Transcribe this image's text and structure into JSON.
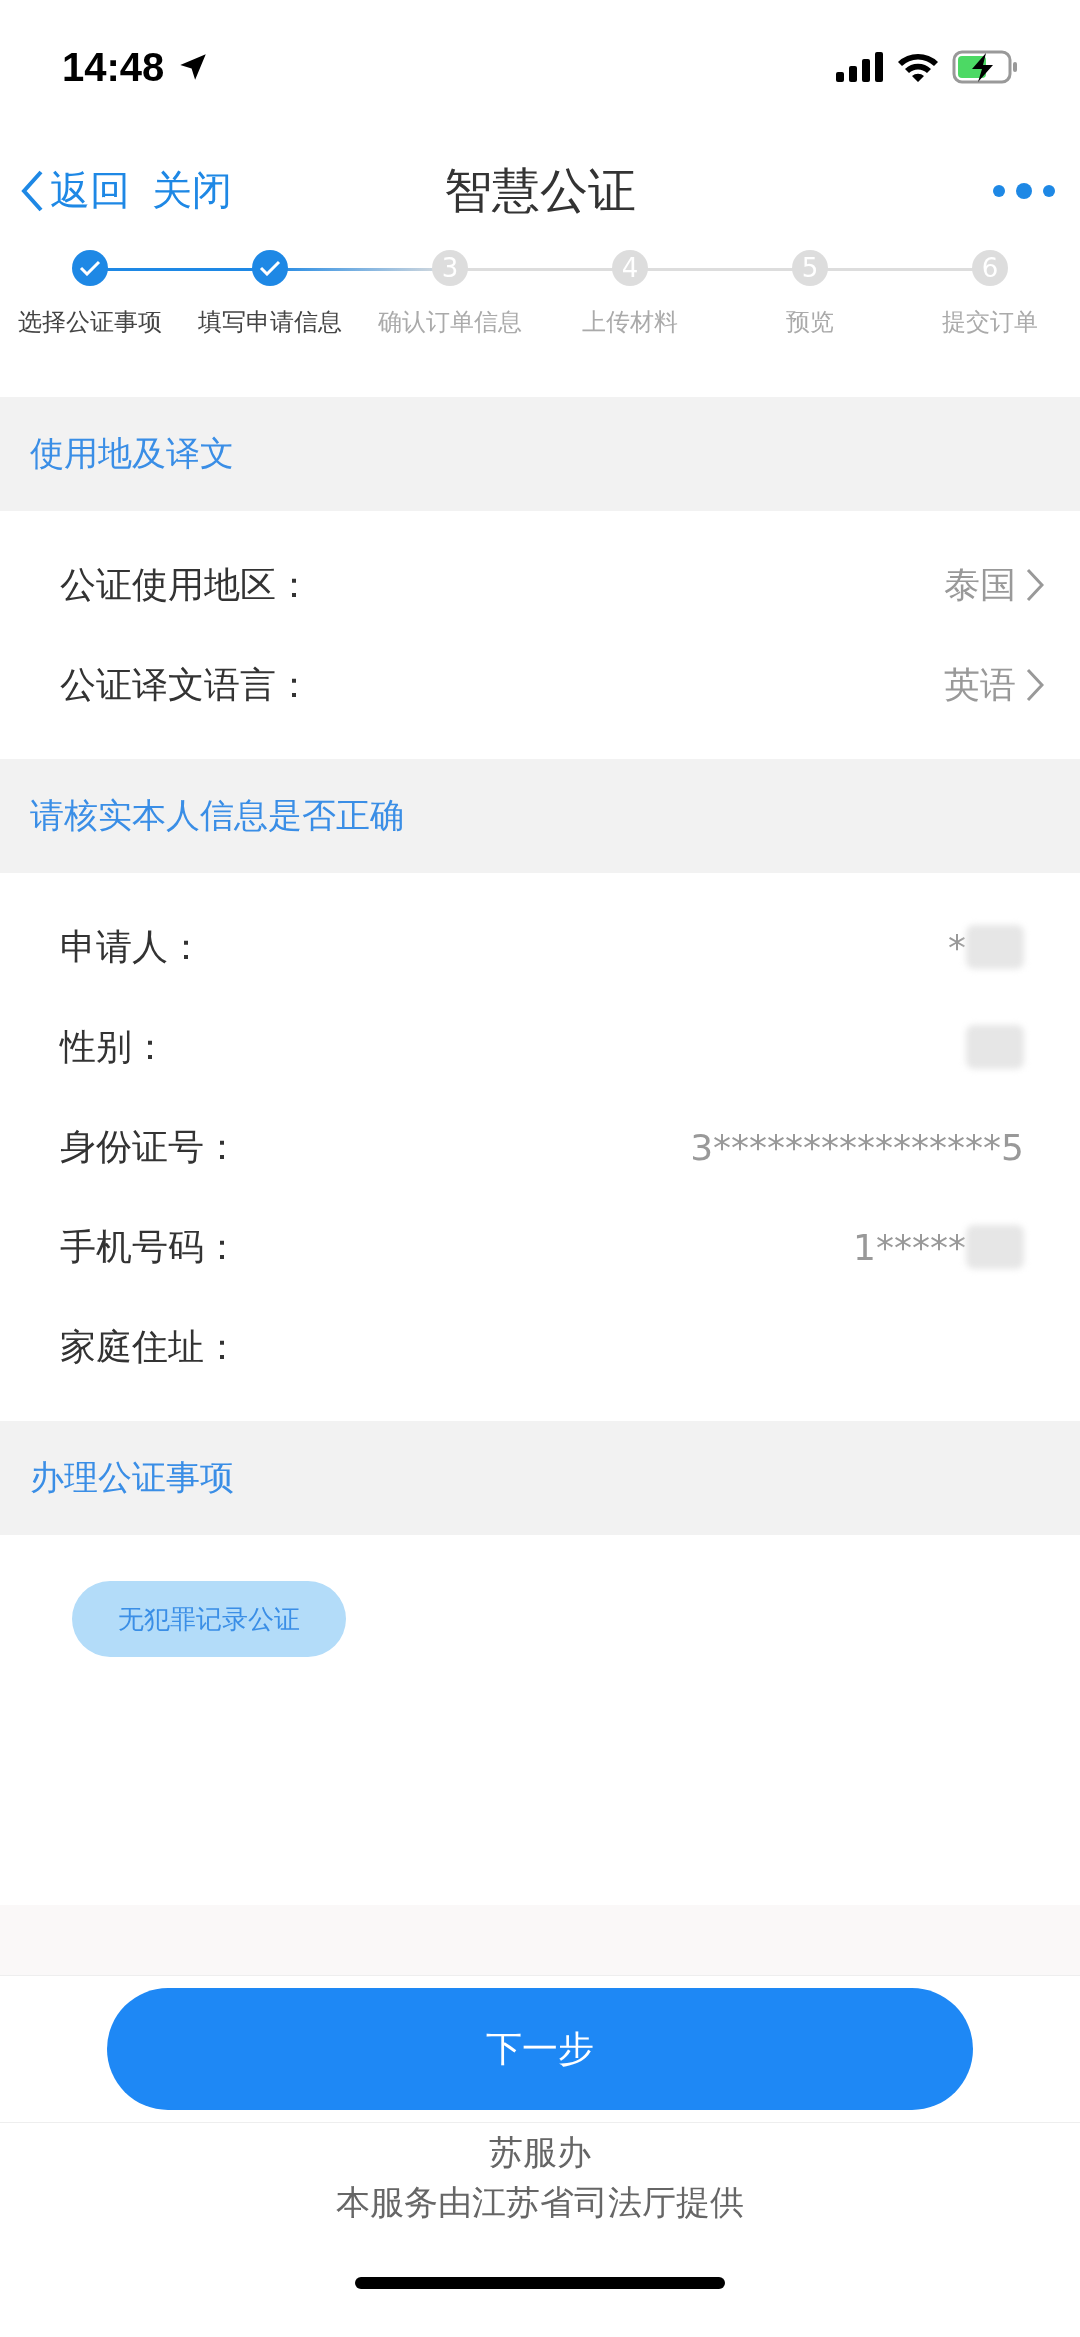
{
  "status_bar": {
    "time": "14:48"
  },
  "nav": {
    "back": "返回",
    "close": "关闭",
    "title": "智慧公证"
  },
  "steps": [
    {
      "label": "选择公证事项",
      "done": true
    },
    {
      "label": "填写申请信息",
      "done": true
    },
    {
      "number": "3",
      "label": "确认订单信息",
      "done": false
    },
    {
      "number": "4",
      "label": "上传材料",
      "done": false
    },
    {
      "number": "5",
      "label": "预览",
      "done": false
    },
    {
      "number": "6",
      "label": "提交订单",
      "done": false
    }
  ],
  "sections": [
    {
      "title": "使用地及译文",
      "kind": "select",
      "rows": [
        {
          "label": "公证使用地区：",
          "value": "泰国"
        },
        {
          "label": "公证译文语言：",
          "value": "英语"
        }
      ]
    },
    {
      "title": "请核实本人信息是否正确",
      "kind": "info",
      "rows": [
        {
          "label": "申请人：",
          "value": "*",
          "blurred": true
        },
        {
          "label": "性别：",
          "blurred": true
        },
        {
          "label": "身份证号：",
          "value": "3****************5",
          "blurred": false
        },
        {
          "label": "手机号码：",
          "value": "1*****",
          "blurred": true
        },
        {
          "label": "家庭住址：",
          "blurred": false
        }
      ]
    },
    {
      "title": "办理公证事项",
      "kind": "chips",
      "chips": [
        "无犯罪记录公证"
      ]
    }
  ],
  "next_button": "下一步",
  "footer": [
    "苏服办",
    "本服务由江苏省司法厅提供"
  ]
}
